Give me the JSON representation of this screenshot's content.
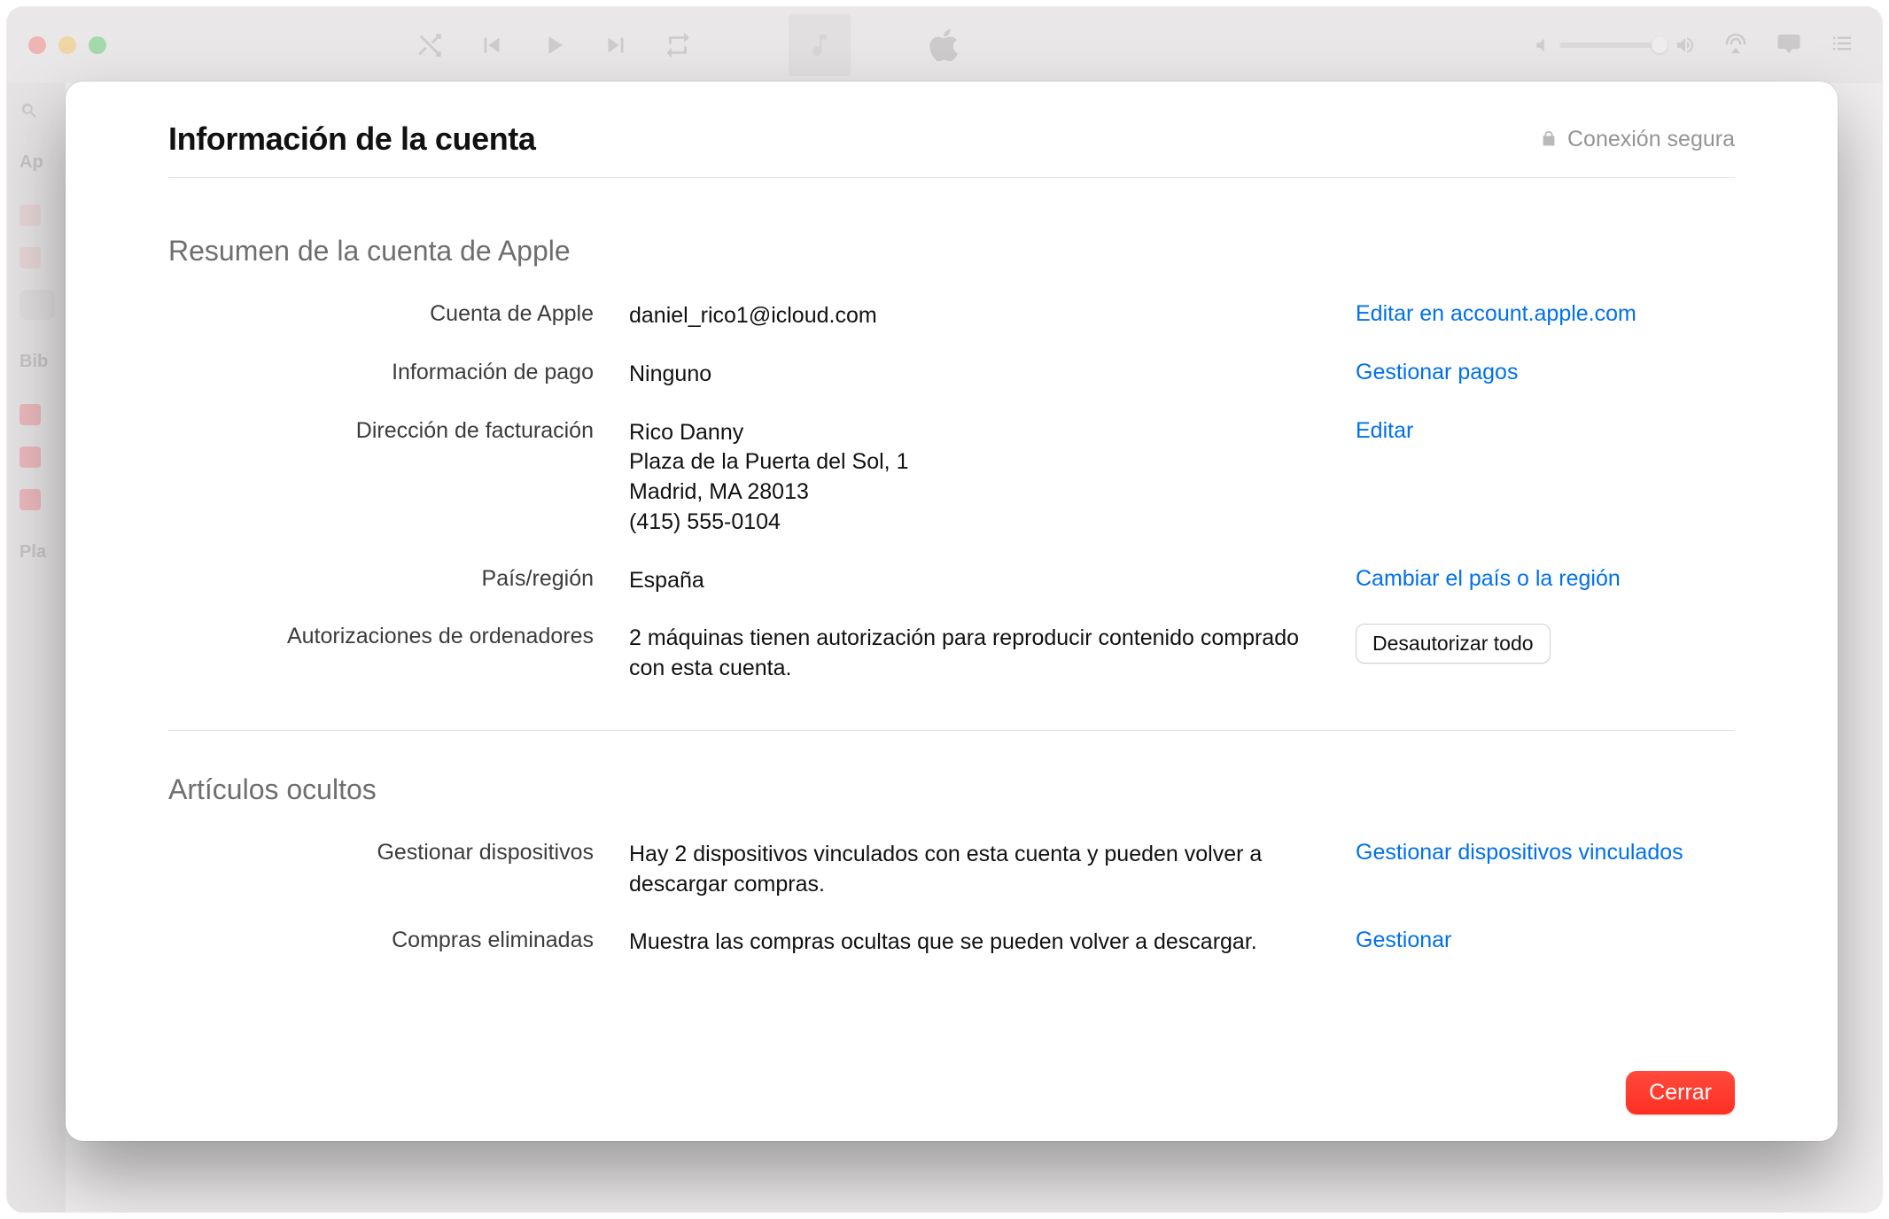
{
  "sidebar": {
    "section1": "Ap",
    "section2": "Bib",
    "section3": "Pla"
  },
  "modal": {
    "title": "Información de la cuenta",
    "secure_label": "Conexión segura",
    "close_button": "Cerrar",
    "summary": {
      "heading": "Resumen de la cuenta de Apple",
      "apple_account": {
        "label": "Cuenta de Apple",
        "value": "daniel_rico1@icloud.com",
        "action": "Editar en account.apple.com"
      },
      "payment": {
        "label": "Información de pago",
        "value": "Ninguno",
        "action": "Gestionar pagos"
      },
      "billing": {
        "label": "Dirección de facturación",
        "line1": "Rico Danny",
        "line2": "Plaza de la Puerta del Sol, 1",
        "line3": "Madrid, MA 28013",
        "line4": "(415) 555-0104",
        "action": "Editar"
      },
      "country": {
        "label": "País/región",
        "value": "España",
        "action": "Cambiar el país o la región"
      },
      "auth": {
        "label": "Autorizaciones de ordenadores",
        "value": "2 máquinas tienen autorización para reproducir contenido comprado con esta cuenta.",
        "action": "Desautorizar todo"
      }
    },
    "hidden": {
      "heading": "Artículos ocultos",
      "devices": {
        "label": "Gestionar dispositivos",
        "value": "Hay 2 dispositivos vinculados con esta cuenta y pueden volver a descargar compras.",
        "action": "Gestionar dispositivos vinculados"
      },
      "purchases": {
        "label": "Compras eliminadas",
        "value": "Muestra las compras ocultas que se pueden volver a descargar.",
        "action": "Gestionar"
      }
    }
  }
}
